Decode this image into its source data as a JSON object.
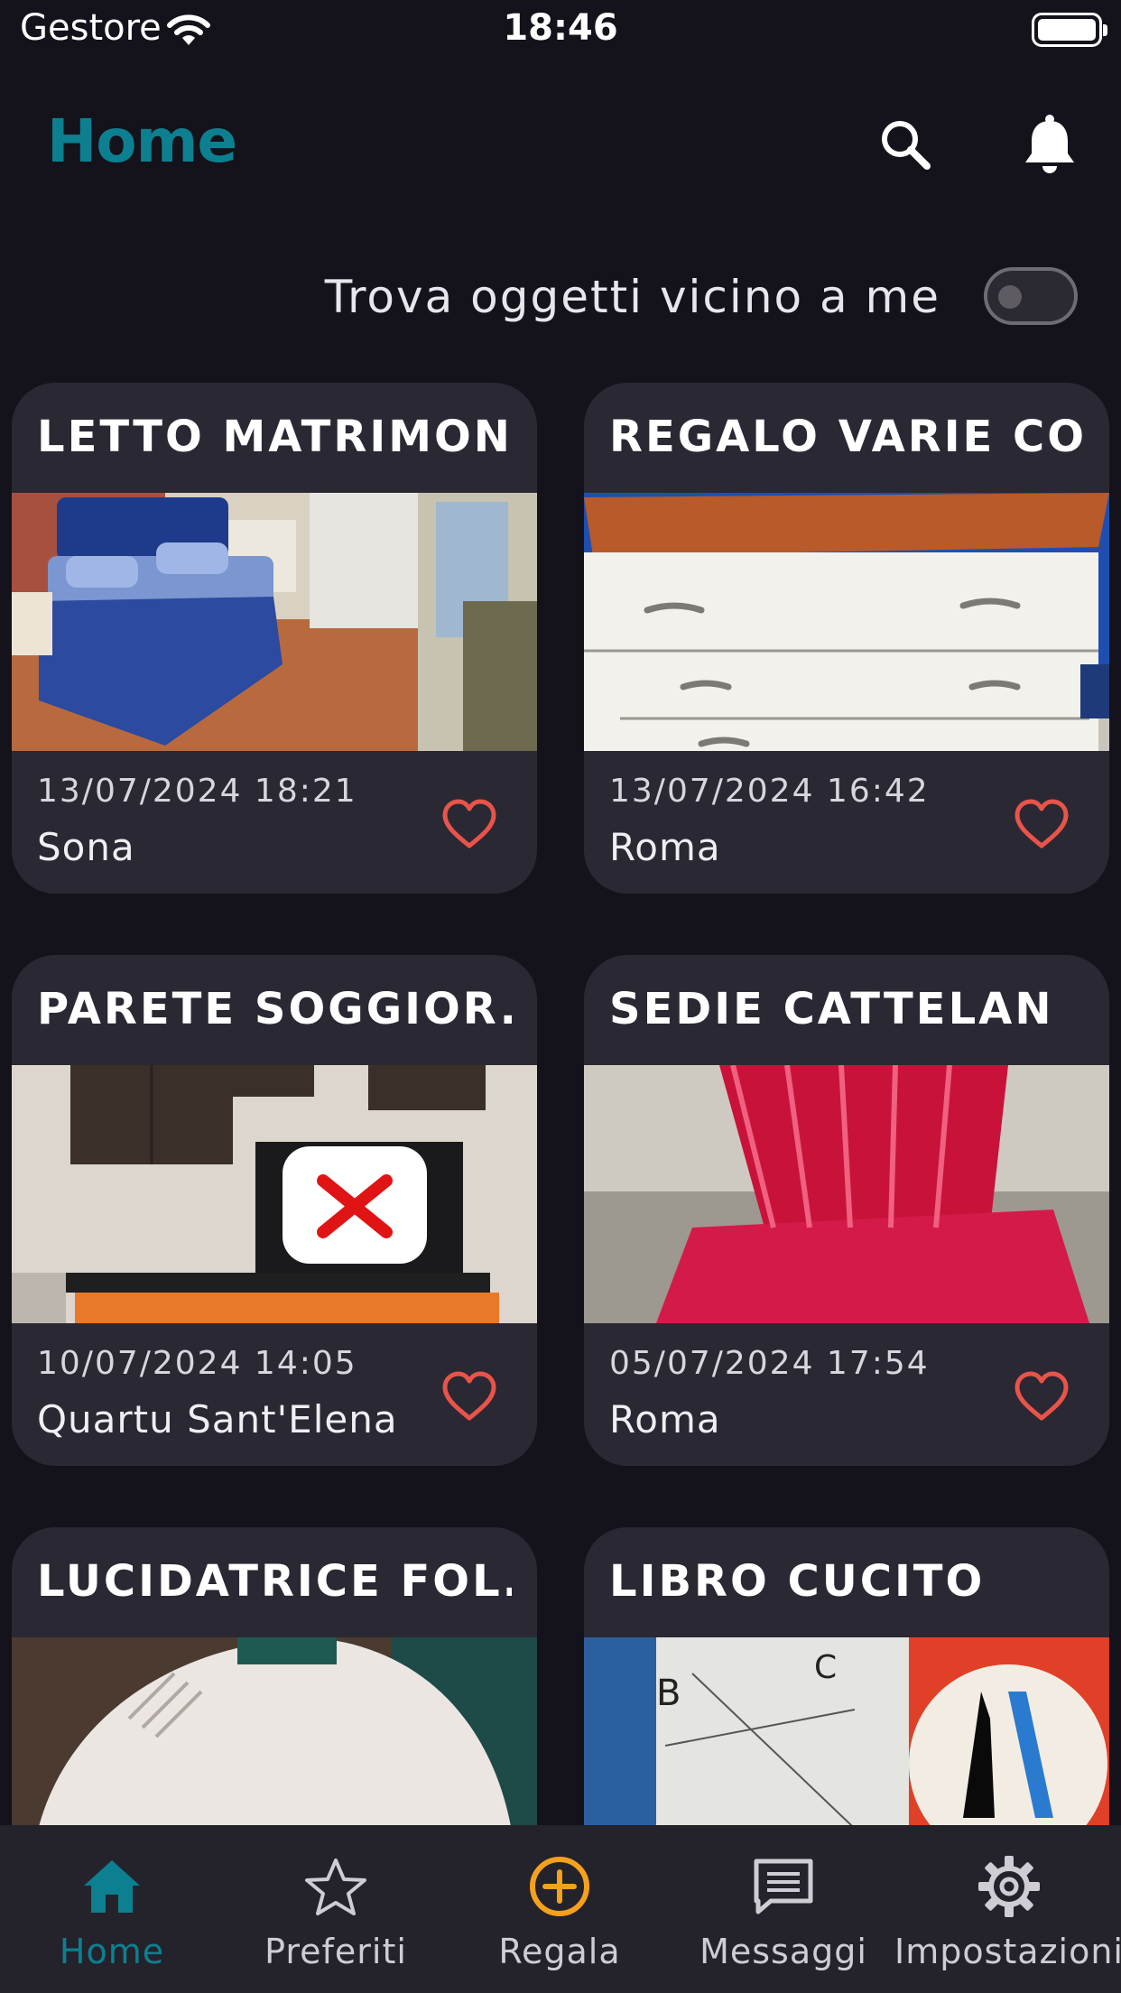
{
  "status_bar": {
    "carrier": "Gestore",
    "time": "18:46"
  },
  "header": {
    "title": "Home"
  },
  "nearby": {
    "label": "Trova oggetti vicino a me",
    "enabled": false
  },
  "items": [
    {
      "title": "LETTO MATRIMON...",
      "date": "13/07/2024 18:21",
      "location": "Sona"
    },
    {
      "title": "REGALO VARIE CO...",
      "date": "13/07/2024 16:42",
      "location": "Roma"
    },
    {
      "title": "PARETE SOGGIOR...",
      "date": "10/07/2024 14:05",
      "location": "Quartu Sant'Elena"
    },
    {
      "title": "SEDIE CATTELAN",
      "date": "05/07/2024 17:54",
      "location": "Roma"
    },
    {
      "title": "LUCIDATRICE FOL...",
      "date": "",
      "location": ""
    },
    {
      "title": "LIBRO CUCITO",
      "date": "",
      "location": ""
    }
  ],
  "tabs": [
    {
      "label": "Home",
      "icon": "home-icon",
      "active": true
    },
    {
      "label": "Preferiti",
      "icon": "star-icon",
      "active": false
    },
    {
      "label": "Regala",
      "icon": "plus-circle-icon",
      "active": false
    },
    {
      "label": "Messaggi",
      "icon": "message-icon",
      "active": false
    },
    {
      "label": "Impostazioni",
      "icon": "gear-icon",
      "active": false
    }
  ],
  "colors": {
    "accent": "#0c8090",
    "background": "#14121a",
    "card": "#2a2833",
    "favorite": "#e8544a",
    "regala": "#f5a11c"
  }
}
